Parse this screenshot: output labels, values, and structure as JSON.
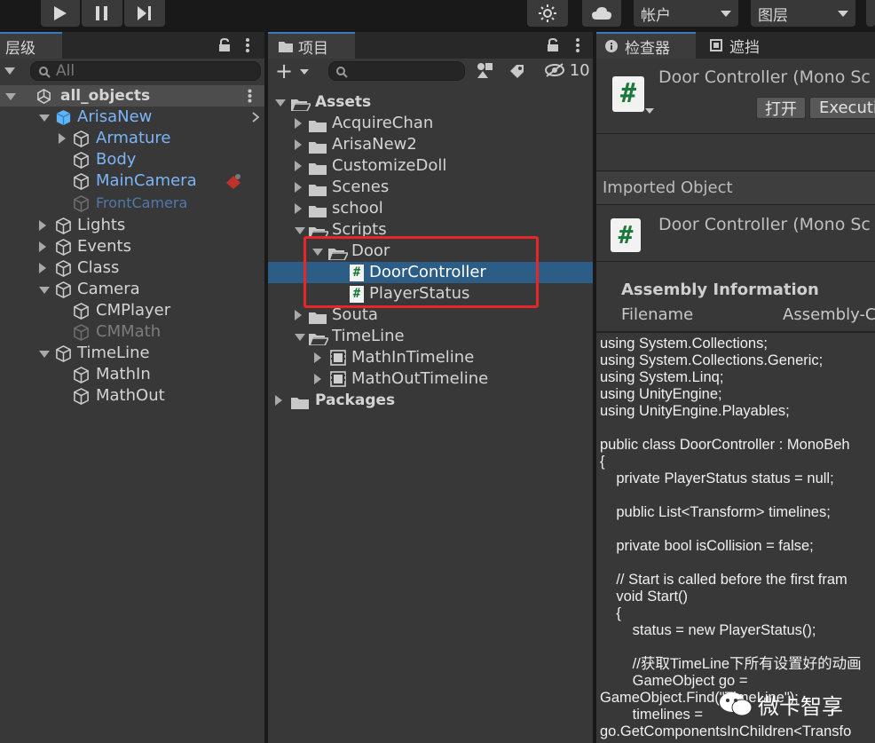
{
  "toolbar": {
    "play_icon": "play-icon",
    "pause_icon": "pause-icon",
    "step_icon": "step-icon",
    "account_label": "帐户",
    "layers_label": "图层"
  },
  "hierarchy": {
    "tab_label": "层级",
    "search_placeholder": "All",
    "items": [
      {
        "label": "all_objects",
        "indent": 0
      },
      {
        "label": "ArisaNew"
      },
      {
        "label": "Armature"
      },
      {
        "label": "Body"
      },
      {
        "label": "MainCamera"
      },
      {
        "label": "FrontCamera"
      },
      {
        "label": "Lights"
      },
      {
        "label": "Events"
      },
      {
        "label": "Class"
      },
      {
        "label": "Camera"
      },
      {
        "label": "CMPlayer"
      },
      {
        "label": "CMMath"
      },
      {
        "label": "TimeLine"
      },
      {
        "label": "MathIn"
      },
      {
        "label": "MathOut"
      }
    ]
  },
  "project": {
    "tab_label": "项目",
    "add_label": "+",
    "hidden_count": "10",
    "items": [
      {
        "label": "Assets"
      },
      {
        "label": "AcquireChan"
      },
      {
        "label": "ArisaNew2"
      },
      {
        "label": "CustomizeDoll"
      },
      {
        "label": "Scenes"
      },
      {
        "label": "school"
      },
      {
        "label": "Scripts"
      },
      {
        "label": "Door"
      },
      {
        "label": "DoorController"
      },
      {
        "label": "PlayerStatus"
      },
      {
        "label": "Souta"
      },
      {
        "label": "TimeLine"
      },
      {
        "label": "MathInTimeline"
      },
      {
        "label": "MathOutTimeline"
      },
      {
        "label": "Packages"
      }
    ]
  },
  "inspector": {
    "tab_label": "检查器",
    "tab2_label": "遮挡",
    "title": "Door Controller (Mono Sc",
    "open_label": "打开",
    "exec_label": "Executi",
    "imported_label": "Imported Object",
    "title2": "Door Controller (Mono Sc",
    "assembly_heading": "Assembly Information",
    "filename_label": "Filename",
    "filename_value": "Assembly-C",
    "code": "using System.Collections;\nusing System.Collections.Generic;\nusing System.Linq;\nusing UnityEngine;\nusing UnityEngine.Playables;\n\npublic class DoorController : MonoBeh\n{\n    private PlayerStatus status = null;\n\n    public List<Transform> timelines;\n\n    private bool isCollision = false;\n\n    // Start is called before the first fram\n    void Start()\n    {\n        status = new PlayerStatus();\n\n        //获取TimeLine下所有设置好的动画\n        GameObject go =\nGameObject.Find(\"TimeLine\");\n        timelines =\ngo.GetComponentsInChildren<Transfo"
  },
  "watermark": "微卡智享",
  "colors": {
    "accent": "#2c5d87",
    "highlight_box": "#e8262a",
    "prefab_blue": "#7cb4f8"
  }
}
